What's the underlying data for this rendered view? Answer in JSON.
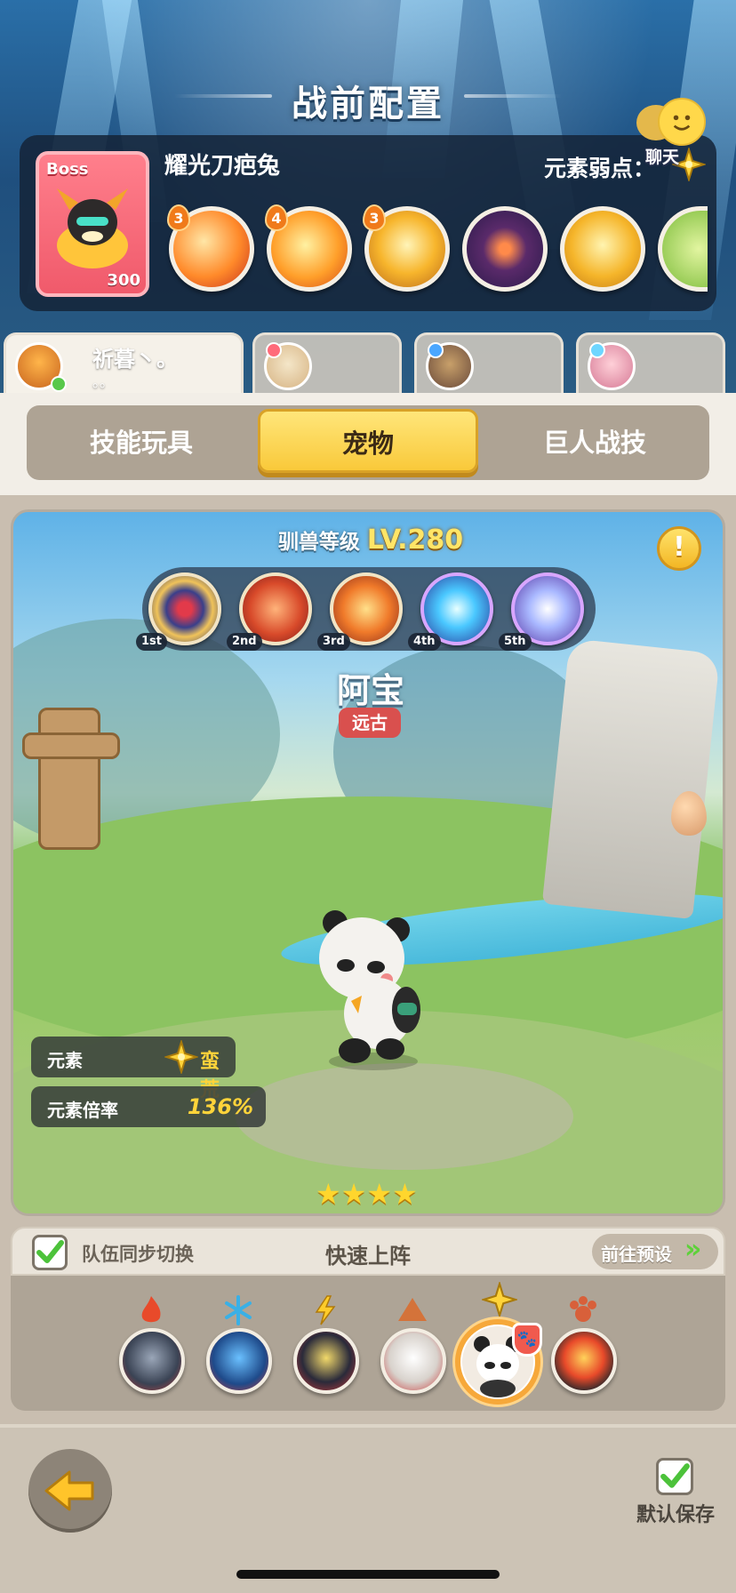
{
  "header": {
    "title": "战前配置"
  },
  "boss": {
    "tag": "Boss",
    "number": "300",
    "name": "耀光刀疤兔",
    "weakness_label": "元素弱点：",
    "weakness_icon": "barbarian-element-icon",
    "skills": [
      {
        "icon": "fire-slash-skill-icon",
        "level": "3"
      },
      {
        "icon": "fire-claw-skill-icon",
        "level": "4"
      },
      {
        "icon": "golden-shield-skill-icon",
        "level": "3"
      },
      {
        "icon": "dark-roar-skill-icon",
        "level": ""
      },
      {
        "icon": "holy-shield-skill-icon",
        "level": ""
      },
      {
        "icon": "partial-skill-icon",
        "level": ""
      }
    ]
  },
  "players": {
    "active_name": "祈暮丶。",
    "active_sub": "。。",
    "tabs": [
      {
        "icon": "player-avatar-icon",
        "active": true
      },
      {
        "icon": "player-avatar-icon",
        "active": false
      },
      {
        "icon": "player-avatar-icon",
        "active": false
      },
      {
        "icon": "player-avatar-icon",
        "active": false
      }
    ]
  },
  "segment_tabs": {
    "skill_toys": "技能玩具",
    "pets": "宠物",
    "giant_skills": "巨人战技",
    "selected": "pets"
  },
  "pet": {
    "tame_label": "驯兽等级",
    "tame_level": "LV.280",
    "info_icon_text": "!",
    "name": "阿宝",
    "rarity": "远古",
    "skills": [
      {
        "icon": "heart-target-skill-icon",
        "rank": "1st"
      },
      {
        "icon": "triple-claw-skill-icon",
        "rank": "2nd"
      },
      {
        "icon": "cross-slash-skill-icon",
        "rank": "3rd"
      },
      {
        "icon": "frost-burst-skill-icon",
        "rank": "4th"
      },
      {
        "icon": "crystal-shard-skill-icon",
        "rank": "5th"
      }
    ],
    "element_label": "元素",
    "element_value": "蛮荒",
    "ratio_label": "元素倍率",
    "ratio_value": "136%",
    "stars": "★★★★",
    "star_count": 4
  },
  "chat": {
    "label": "聊天"
  },
  "team": {
    "sync_label": "队伍同步切换",
    "sync_checked": true,
    "quick_label": "快速上阵",
    "preset_label": "前往预设",
    "preset_arrows": "»",
    "slots": [
      {
        "element": "fire-icon",
        "pet": "wolf-pet-icon",
        "active": false
      },
      {
        "element": "ice-icon",
        "pet": "blue-beast-pet-icon",
        "active": false
      },
      {
        "element": "lightning-icon",
        "pet": "penguin-pet-icon",
        "active": false
      },
      {
        "element": "earth-icon",
        "pet": "white-cat-pet-icon",
        "active": false
      },
      {
        "element": "barbarian-icon",
        "pet": "panda-pet-icon",
        "active": true
      },
      {
        "element": "beast-icon",
        "pet": "fire-penguin-pet-icon",
        "active": false
      }
    ]
  },
  "footer": {
    "save_label": "默认保存",
    "save_checked": true
  },
  "colors": {
    "accent_yellow": "#f9c93a",
    "rarity_red": "#d9504e",
    "check_green": "#4cc23a",
    "stat_yellow": "#ffd43a"
  }
}
